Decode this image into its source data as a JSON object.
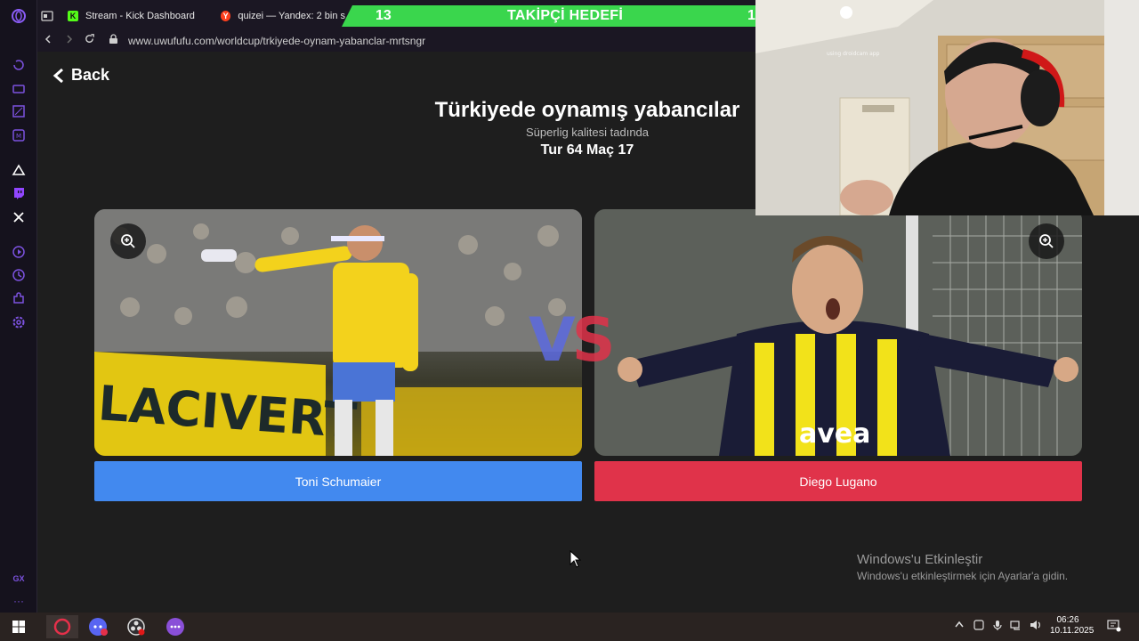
{
  "browser": {
    "tabs": [
      {
        "label": "Stream - Kick Dashboard",
        "favicon": "kick-icon",
        "favicon_color": "#53fc18"
      },
      {
        "label": "quizei — Yandex: 2 bin s",
        "favicon": "yandex-icon",
        "favicon_color": "#fc3f1d"
      }
    ],
    "url": "www.uwufufu.com/worldcup/trkiyede-oynam-yabanclar-mrtsngr"
  },
  "goal_overlay": {
    "current": "13",
    "title": "TAKİPÇİ HEDEFİ",
    "target": "1",
    "color": "#3ad64d"
  },
  "page": {
    "back_label": "Back",
    "title": "Türkiyede oynamış yabancılar",
    "subtitle": "Süperlig kalitesi tadında",
    "round": "Tur 64 Maç 17",
    "vs_v": "V",
    "vs_s": "S",
    "left": {
      "name": "Toni Schumaier",
      "color": "#4289ef"
    },
    "right": {
      "name": "Diego Lugano",
      "color": "#e0334a"
    }
  },
  "windows_activation": {
    "title": "Windows'u Etkinleştir",
    "subtitle": "Windows'u etkinleştirmek için Ayarlar'a gidin."
  },
  "taskbar": {
    "time": "06:26",
    "date": "10.11.2025"
  }
}
